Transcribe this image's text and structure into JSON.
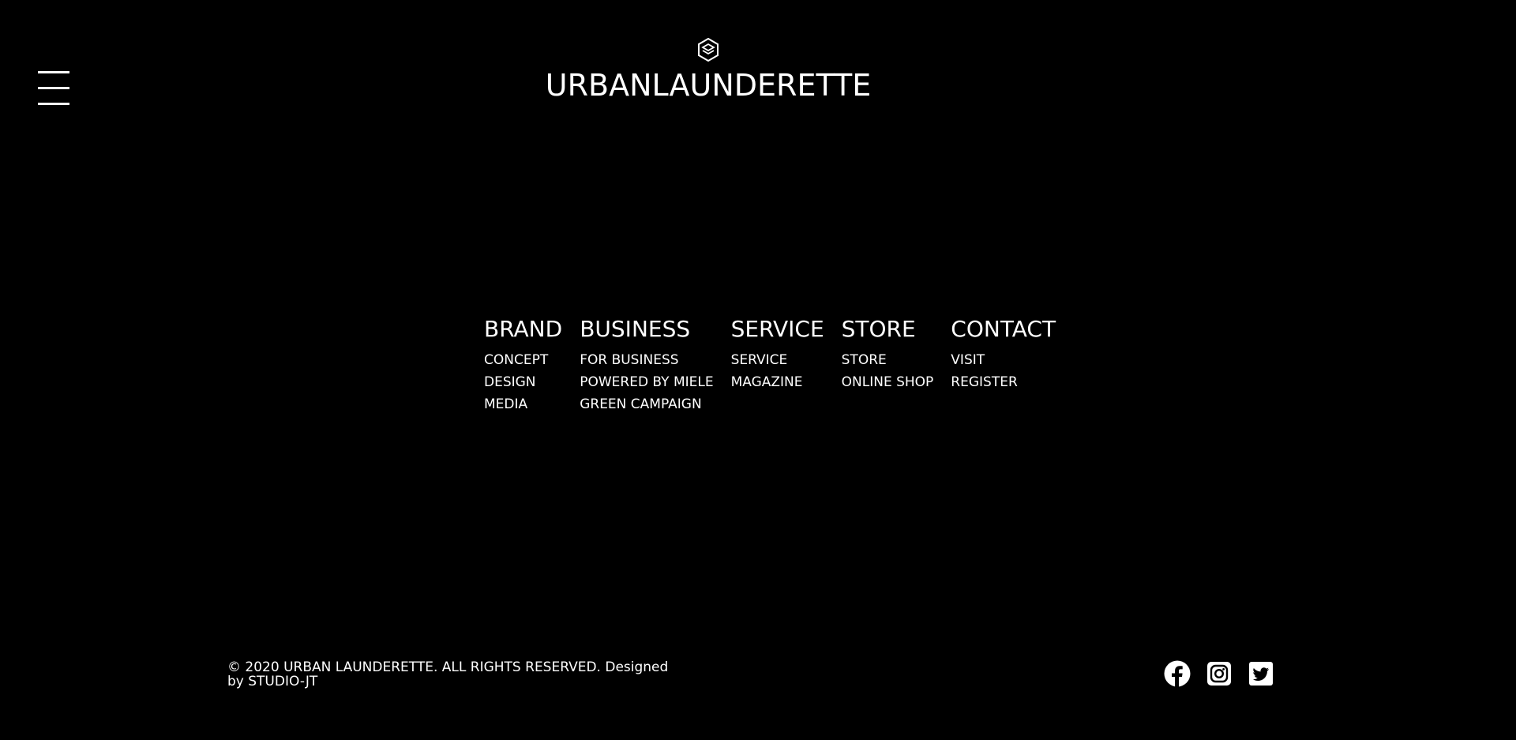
{
  "header": {
    "menu_icon": "hamburger-menu-icon",
    "logo_icon": "logo-mark-icon",
    "logo_text": "URBANLAUNDERETTE"
  },
  "menu": {
    "columns": [
      {
        "heading": "BRAND",
        "links": [
          "CONCEPT",
          "DESIGN",
          "MEDIA"
        ]
      },
      {
        "heading": "BUSINESS",
        "links": [
          "FOR BUSINESS",
          "POWERED BY MIELE",
          "GREEN CAMPAIGN"
        ]
      },
      {
        "heading": "SERVICE",
        "links": [
          "SERVICE",
          "MAGAZINE"
        ]
      },
      {
        "heading": "STORE",
        "links": [
          "STORE",
          "ONLINE SHOP"
        ]
      },
      {
        "heading": "CONTACT",
        "links": [
          "VISIT",
          "REGISTER"
        ]
      }
    ]
  },
  "footer": {
    "copyright": "© 2020 URBAN LAUNDERETTE. ALL RIGHTS RESERVED. Designed by STUDIO-JT",
    "social": [
      {
        "icon": "facebook-icon"
      },
      {
        "icon": "instagram-icon"
      },
      {
        "icon": "twitter-icon"
      }
    ]
  },
  "colors": {
    "background": "#000000",
    "foreground": "#ffffff"
  }
}
